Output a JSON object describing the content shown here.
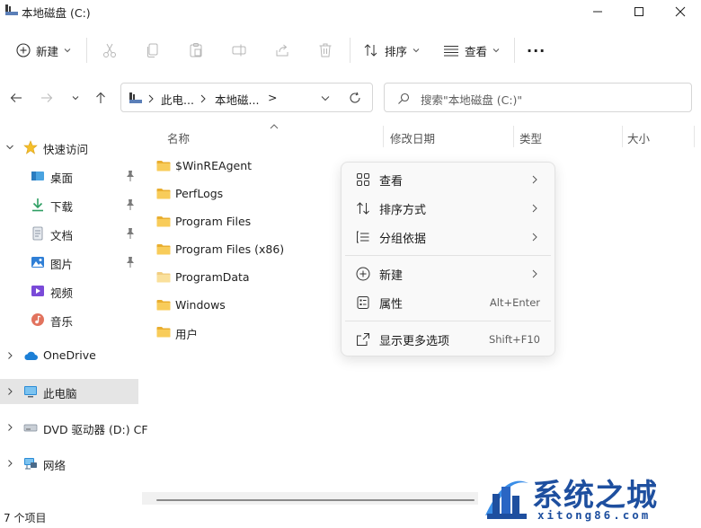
{
  "window": {
    "title": "本地磁盘 (C:)"
  },
  "toolbar": {
    "new_label": "新建",
    "sort_label": "排序",
    "view_label": "查看",
    "more_label": "···"
  },
  "address": {
    "crumbs": [
      "此电...",
      "本地磁...",
      ">"
    ],
    "search_placeholder": "搜索\"本地磁盘 (C:)\""
  },
  "sidebar": {
    "items": [
      {
        "label": "快速访问",
        "icon": "star-icon"
      },
      {
        "label": "桌面",
        "icon": "desktop-icon"
      },
      {
        "label": "下载",
        "icon": "download-icon"
      },
      {
        "label": "文档",
        "icon": "document-icon"
      },
      {
        "label": "图片",
        "icon": "picture-icon"
      },
      {
        "label": "视频",
        "icon": "video-icon"
      },
      {
        "label": "音乐",
        "icon": "music-icon"
      },
      {
        "label": "OneDrive",
        "icon": "cloud-icon"
      },
      {
        "label": "此电脑",
        "icon": "computer-icon"
      },
      {
        "label": "DVD 驱动器 (D:) CF",
        "icon": "dvd-icon"
      },
      {
        "label": "网络",
        "icon": "network-icon"
      }
    ]
  },
  "columns": {
    "name": "名称",
    "modified": "修改日期",
    "type": "类型",
    "size": "大小"
  },
  "files": [
    {
      "name": "$WinREAgent"
    },
    {
      "name": "PerfLogs"
    },
    {
      "name": "Program Files"
    },
    {
      "name": "Program Files (x86)"
    },
    {
      "name": "ProgramData"
    },
    {
      "name": "Windows"
    },
    {
      "name": "用户"
    }
  ],
  "context_menu": {
    "items": [
      {
        "label": "查看",
        "icon": "grid-icon",
        "submenu": true
      },
      {
        "label": "排序方式",
        "icon": "sort-icon",
        "submenu": true
      },
      {
        "label": "分组依据",
        "icon": "group-icon",
        "submenu": true
      },
      {
        "label": "新建",
        "icon": "plus-circle-icon",
        "submenu": true
      },
      {
        "label": "属性",
        "icon": "properties-icon",
        "shortcut": "Alt+Enter"
      },
      {
        "label": "显示更多选项",
        "icon": "more-options-icon",
        "shortcut": "Shift+F10"
      }
    ]
  },
  "status": {
    "item_count": "7 个项目"
  },
  "watermark": {
    "text": "系统之城",
    "url": "xitong86.com"
  },
  "colors": {
    "folder": "#f3c04a",
    "accent": "#1e4f9f",
    "selected": "#e5e5e5"
  }
}
